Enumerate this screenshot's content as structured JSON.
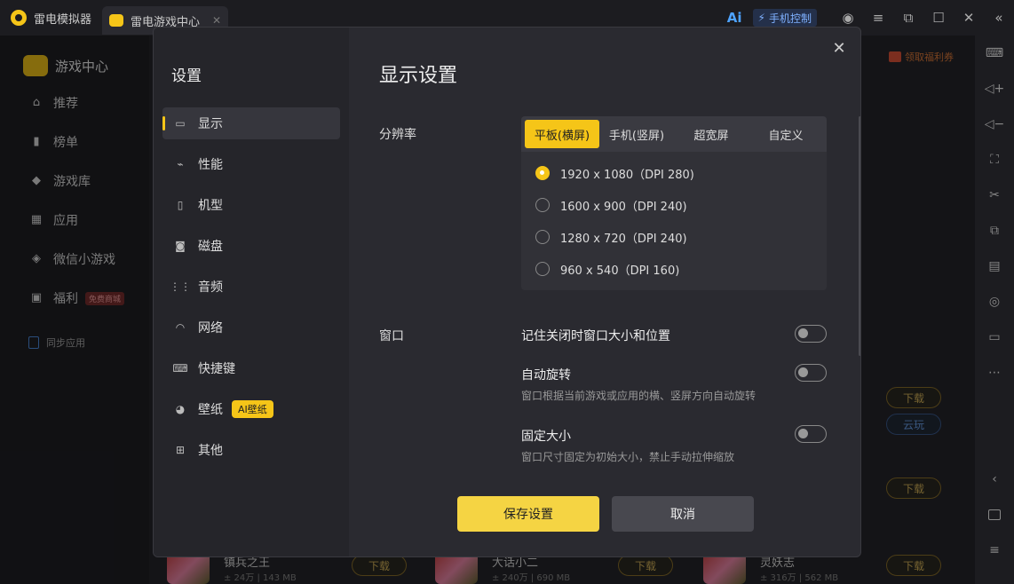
{
  "titlebar": {
    "app_name": "雷电模拟器",
    "tab_label": "雷电游戏中心",
    "tab_close": "✕",
    "ai_label": "Ai",
    "phone_control": "手机控制"
  },
  "sidebar": {
    "title": "游戏中心",
    "items": [
      {
        "label": "推荐",
        "icon": "home-icon"
      },
      {
        "label": "榜单",
        "icon": "chart-icon"
      },
      {
        "label": "游戏库",
        "icon": "gamepad-icon"
      },
      {
        "label": "应用",
        "icon": "apps-icon"
      },
      {
        "label": "微信小游戏",
        "icon": "diamond-icon"
      },
      {
        "label": "福利",
        "icon": "gift-icon",
        "badge": "免费商城"
      }
    ],
    "sync": "同步应用"
  },
  "background": {
    "welfare": "领取福利券",
    "download": "下载",
    "cloud_play": "云玩",
    "bottom_games": [
      {
        "name": "镇兵之王",
        "meta": "± 24万 | 143 MB"
      },
      {
        "name": "大话小二",
        "meta": "± 240万 | 690 MB"
      },
      {
        "name": "灵妖志",
        "meta": "± 316万 | 562 MB"
      }
    ]
  },
  "dialog": {
    "nav_title": "设置",
    "nav": [
      {
        "label": "显示",
        "icon": "monitor-icon",
        "active": true
      },
      {
        "label": "性能",
        "icon": "performance-icon"
      },
      {
        "label": "机型",
        "icon": "phone-icon"
      },
      {
        "label": "磁盘",
        "icon": "disk-icon"
      },
      {
        "label": "音频",
        "icon": "audio-icon"
      },
      {
        "label": "网络",
        "icon": "wifi-icon"
      },
      {
        "label": "快捷键",
        "icon": "keyboard-icon"
      },
      {
        "label": "壁纸",
        "icon": "palette-icon",
        "badge": "AI壁纸"
      },
      {
        "label": "其他",
        "icon": "grid-icon"
      }
    ],
    "title": "显示设置",
    "resolution": {
      "label": "分辨率",
      "tabs": [
        "平板(横屏)",
        "手机(竖屏)",
        "超宽屏",
        "自定义"
      ],
      "active_tab": 0,
      "options": [
        "1920 x 1080（DPI 280)",
        "1600 x 900（DPI 240)",
        "1280 x 720（DPI 240)",
        "960 x 540（DPI 160)"
      ],
      "selected": 0
    },
    "window": {
      "label": "窗口",
      "remember": "记住关闭时窗口大小和位置",
      "auto_rotate": "自动旋转",
      "auto_rotate_desc": "窗口根据当前游戏或应用的横、竖屏方向自动旋转",
      "fixed_size": "固定大小",
      "fixed_size_desc": "窗口尺寸固定为初始大小，禁止手动拉伸缩放"
    },
    "save": "保存设置",
    "cancel": "取消",
    "close": "✕"
  },
  "colors": {
    "accent": "#f5c518"
  }
}
